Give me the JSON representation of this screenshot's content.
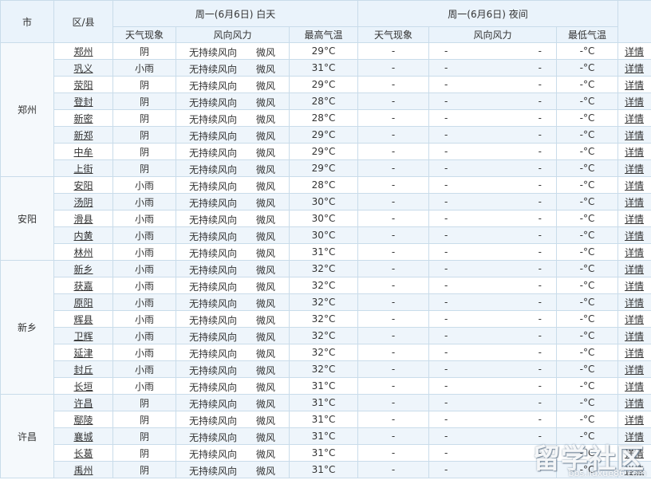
{
  "header": {
    "city": "市",
    "district": "区/县",
    "day_group": "周一(6月6日) 白天",
    "night_group": "周一(6月6日) 夜间",
    "day_weather": "天气现象",
    "day_wind": "风向风力",
    "day_temp": "最高气温",
    "night_weather": "天气现象",
    "night_wind": "风向风力",
    "night_temp": "最低气温"
  },
  "detail_label": "详情",
  "night_placeholder": "-",
  "night_temp_placeholder": "-°C",
  "groups": [
    {
      "city": "郑州",
      "rows": [
        {
          "district": "郑州",
          "weather": "阴",
          "wind_dir": "无持续风向",
          "wind_power": "微风",
          "temp": "29°C"
        },
        {
          "district": "巩义",
          "weather": "小雨",
          "wind_dir": "无持续风向",
          "wind_power": "微风",
          "temp": "31°C"
        },
        {
          "district": "荥阳",
          "weather": "阴",
          "wind_dir": "无持续风向",
          "wind_power": "微风",
          "temp": "29°C"
        },
        {
          "district": "登封",
          "weather": "阴",
          "wind_dir": "无持续风向",
          "wind_power": "微风",
          "temp": "28°C"
        },
        {
          "district": "新密",
          "weather": "阴",
          "wind_dir": "无持续风向",
          "wind_power": "微风",
          "temp": "28°C"
        },
        {
          "district": "新郑",
          "weather": "阴",
          "wind_dir": "无持续风向",
          "wind_power": "微风",
          "temp": "29°C"
        },
        {
          "district": "中牟",
          "weather": "阴",
          "wind_dir": "无持续风向",
          "wind_power": "微风",
          "temp": "29°C"
        },
        {
          "district": "上街",
          "weather": "阴",
          "wind_dir": "无持续风向",
          "wind_power": "微风",
          "temp": "29°C"
        }
      ]
    },
    {
      "city": "安阳",
      "rows": [
        {
          "district": "安阳",
          "weather": "小雨",
          "wind_dir": "无持续风向",
          "wind_power": "微风",
          "temp": "28°C"
        },
        {
          "district": "汤阴",
          "weather": "小雨",
          "wind_dir": "无持续风向",
          "wind_power": "微风",
          "temp": "30°C"
        },
        {
          "district": "滑县",
          "weather": "小雨",
          "wind_dir": "无持续风向",
          "wind_power": "微风",
          "temp": "30°C"
        },
        {
          "district": "内黄",
          "weather": "小雨",
          "wind_dir": "无持续风向",
          "wind_power": "微风",
          "temp": "30°C"
        },
        {
          "district": "林州",
          "weather": "小雨",
          "wind_dir": "无持续风向",
          "wind_power": "微风",
          "temp": "31°C"
        }
      ]
    },
    {
      "city": "新乡",
      "rows": [
        {
          "district": "新乡",
          "weather": "小雨",
          "wind_dir": "无持续风向",
          "wind_power": "微风",
          "temp": "32°C"
        },
        {
          "district": "获嘉",
          "weather": "小雨",
          "wind_dir": "无持续风向",
          "wind_power": "微风",
          "temp": "32°C"
        },
        {
          "district": "原阳",
          "weather": "小雨",
          "wind_dir": "无持续风向",
          "wind_power": "微风",
          "temp": "32°C"
        },
        {
          "district": "辉县",
          "weather": "小雨",
          "wind_dir": "无持续风向",
          "wind_power": "微风",
          "temp": "32°C"
        },
        {
          "district": "卫辉",
          "weather": "小雨",
          "wind_dir": "无持续风向",
          "wind_power": "微风",
          "temp": "32°C"
        },
        {
          "district": "延津",
          "weather": "小雨",
          "wind_dir": "无持续风向",
          "wind_power": "微风",
          "temp": "32°C"
        },
        {
          "district": "封丘",
          "weather": "小雨",
          "wind_dir": "无持续风向",
          "wind_power": "微风",
          "temp": "32°C"
        },
        {
          "district": "长垣",
          "weather": "小雨",
          "wind_dir": "无持续风向",
          "wind_power": "微风",
          "temp": "31°C"
        }
      ]
    },
    {
      "city": "许昌",
      "rows": [
        {
          "district": "许昌",
          "weather": "阴",
          "wind_dir": "无持续风向",
          "wind_power": "微风",
          "temp": "31°C"
        },
        {
          "district": "鄢陵",
          "weather": "阴",
          "wind_dir": "无持续风向",
          "wind_power": "微风",
          "temp": "31°C"
        },
        {
          "district": "襄城",
          "weather": "阴",
          "wind_dir": "无持续风向",
          "wind_power": "微风",
          "temp": "31°C"
        },
        {
          "district": "长葛",
          "weather": "阴",
          "wind_dir": "无持续风向",
          "wind_power": "微风",
          "temp": "31°C"
        },
        {
          "district": "禹州",
          "weather": "阴",
          "wind_dir": "无持续风向",
          "wind_power": "微风",
          "temp": "31°C"
        }
      ]
    }
  ],
  "watermark": {
    "main": "留学社区",
    "sub": "bbs.liuxue86.com"
  }
}
